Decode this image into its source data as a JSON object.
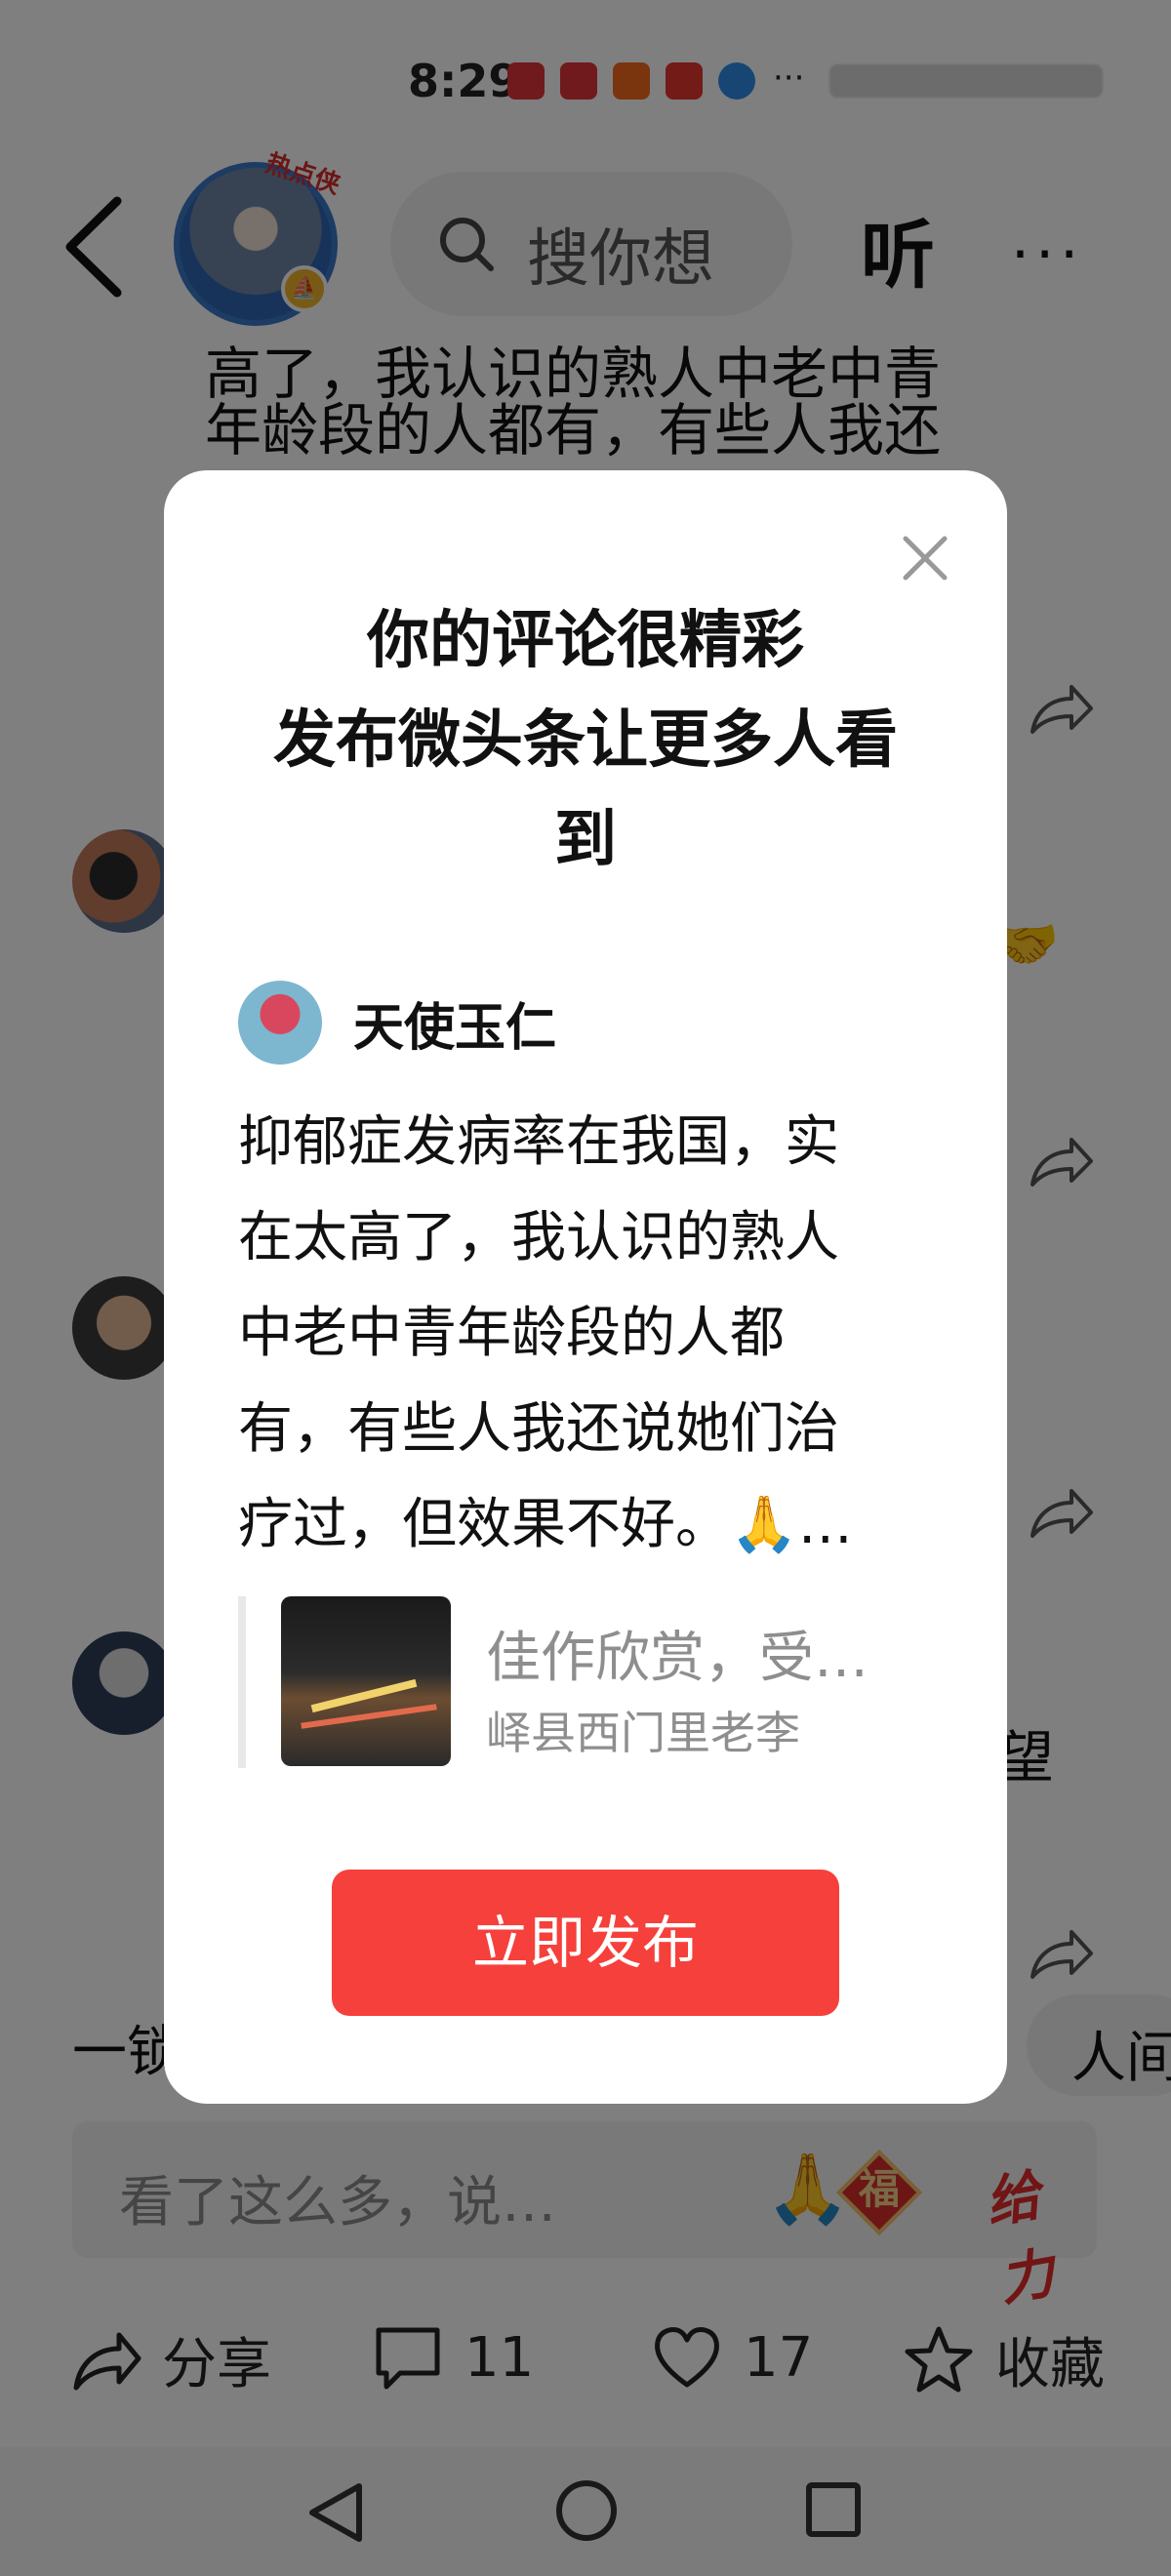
{
  "status_bar": {
    "time": "8:29",
    "more": "···"
  },
  "header": {
    "avatar_tag": "热点侠",
    "search_placeholder": "搜你想",
    "listen_label": "听",
    "more_label": "···"
  },
  "background": {
    "article_lines": [
      "高了，我认识的熟人中老中青",
      "年龄段的人都有，有些人我还"
    ],
    "fragment_wang": "望",
    "quick_left": "一锁",
    "quick_right": "人间"
  },
  "comment_input": {
    "placeholder": "看了这么多，说…",
    "emoji_pray": "🙏",
    "fu_label": "福",
    "geili_label": "给力"
  },
  "actions": {
    "share_label": "分享",
    "comment_count": "11",
    "like_count": "17",
    "favorite_label": "收藏"
  },
  "modal": {
    "title_lines": [
      "你的评论很精彩",
      "发布微头条让更多人看",
      "到"
    ],
    "author_name": "天使玉仁",
    "comment_lines": [
      "抑郁症发病率在我国，实",
      "在太高了，我认识的熟人",
      "中老中青年龄段的人都",
      "有，有些人我还说她们治",
      "疗过，但效果不好。🙏…"
    ],
    "ref_title": "佳作欣赏，受…",
    "ref_author": "峄县西门里老李",
    "publish_label": "立即发布"
  }
}
